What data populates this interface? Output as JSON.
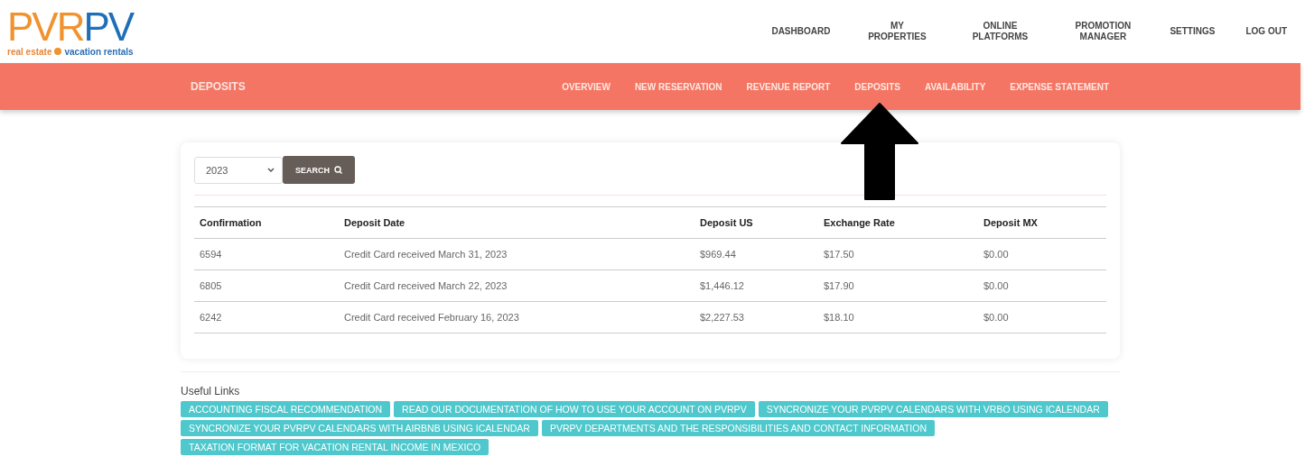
{
  "logo": {
    "wordmark_left": "PVR",
    "wordmark_right": "PV",
    "tagline_left": "real estate",
    "tagline_right": "vacation rentals"
  },
  "top_nav": [
    {
      "label": "DASHBOARD"
    },
    {
      "label": "MY PROPERTIES"
    },
    {
      "label": "ONLINE PLATFORMS"
    },
    {
      "label": "PROMOTION MANAGER"
    },
    {
      "label": "SETTINGS"
    },
    {
      "label": "LOG OUT"
    }
  ],
  "sub_nav": {
    "title": "DEPOSITS",
    "items": [
      "OVERVIEW",
      "NEW RESERVATION",
      "REVENUE REPORT",
      "DEPOSITS",
      "AVAILABILITY",
      "EXPENSE STATEMENT"
    ]
  },
  "filter": {
    "year": "2023",
    "button": "SEARCH"
  },
  "table": {
    "columns": [
      "Confirmation",
      "Deposit Date",
      "Deposit US",
      "Exchange Rate",
      "Deposit MX"
    ],
    "rows": [
      [
        "6594",
        "Credit Card received March 31, 2023",
        "$969.44",
        "$17.50",
        "$0.00"
      ],
      [
        "6805",
        "Credit Card received March 22, 2023",
        "$1,446.12",
        "$17.90",
        "$0.00"
      ],
      [
        "6242",
        "Credit Card received February 16, 2023",
        "$2,227.53",
        "$18.10",
        "$0.00"
      ]
    ]
  },
  "useful_links": {
    "title": "Useful Links",
    "links": [
      "ACCOUNTING FISCAL RECOMMENDATION",
      "READ OUR DOCUMENTATION OF HOW TO USE YOUR ACCOUNT ON PVRPV",
      "SYNCRONIZE YOUR PVRPV CALENDARS WITH VRBO USING ICALENDAR",
      "SYNCRONIZE YOUR PVRPV CALENDARS WITH AIRBNB USING ICALENDAR",
      "PVRPV DEPARTMENTS AND THE RESPONSIBILITIES AND CONTACT INFORMATION",
      "TAXATION FORMAT FOR VACATION RENTAL INCOME IN MEXICO"
    ]
  }
}
